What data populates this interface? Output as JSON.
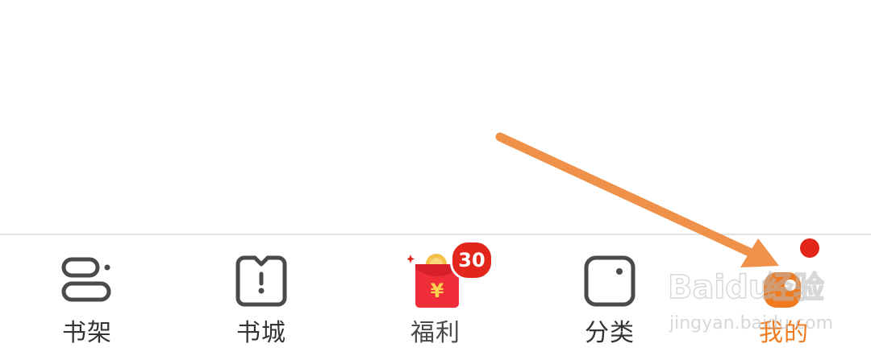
{
  "tabbar": {
    "items": [
      {
        "key": "bookshelf",
        "label": "书架",
        "icon": "bookshelf-icon",
        "active": false
      },
      {
        "key": "bookstore",
        "label": "书城",
        "icon": "book-open-icon",
        "active": false
      },
      {
        "key": "welfare",
        "label": "福利",
        "icon": "red-envelope-icon",
        "badge": "30",
        "active": false
      },
      {
        "key": "category",
        "label": "分类",
        "icon": "category-square-icon",
        "active": false
      },
      {
        "key": "mine",
        "label": "我的",
        "icon": "profile-icon",
        "active": true,
        "dot": true
      }
    ]
  },
  "welfare_icon": {
    "currency_symbol": "¥"
  },
  "watermark": {
    "brand": "Baidu",
    "cn": "经验",
    "url": "jingyan.baidu.com"
  },
  "colors": {
    "active": "#f07a1f",
    "badge": "#e3261b",
    "arrow": "#f0914a",
    "divider": "#e2e2e2"
  }
}
